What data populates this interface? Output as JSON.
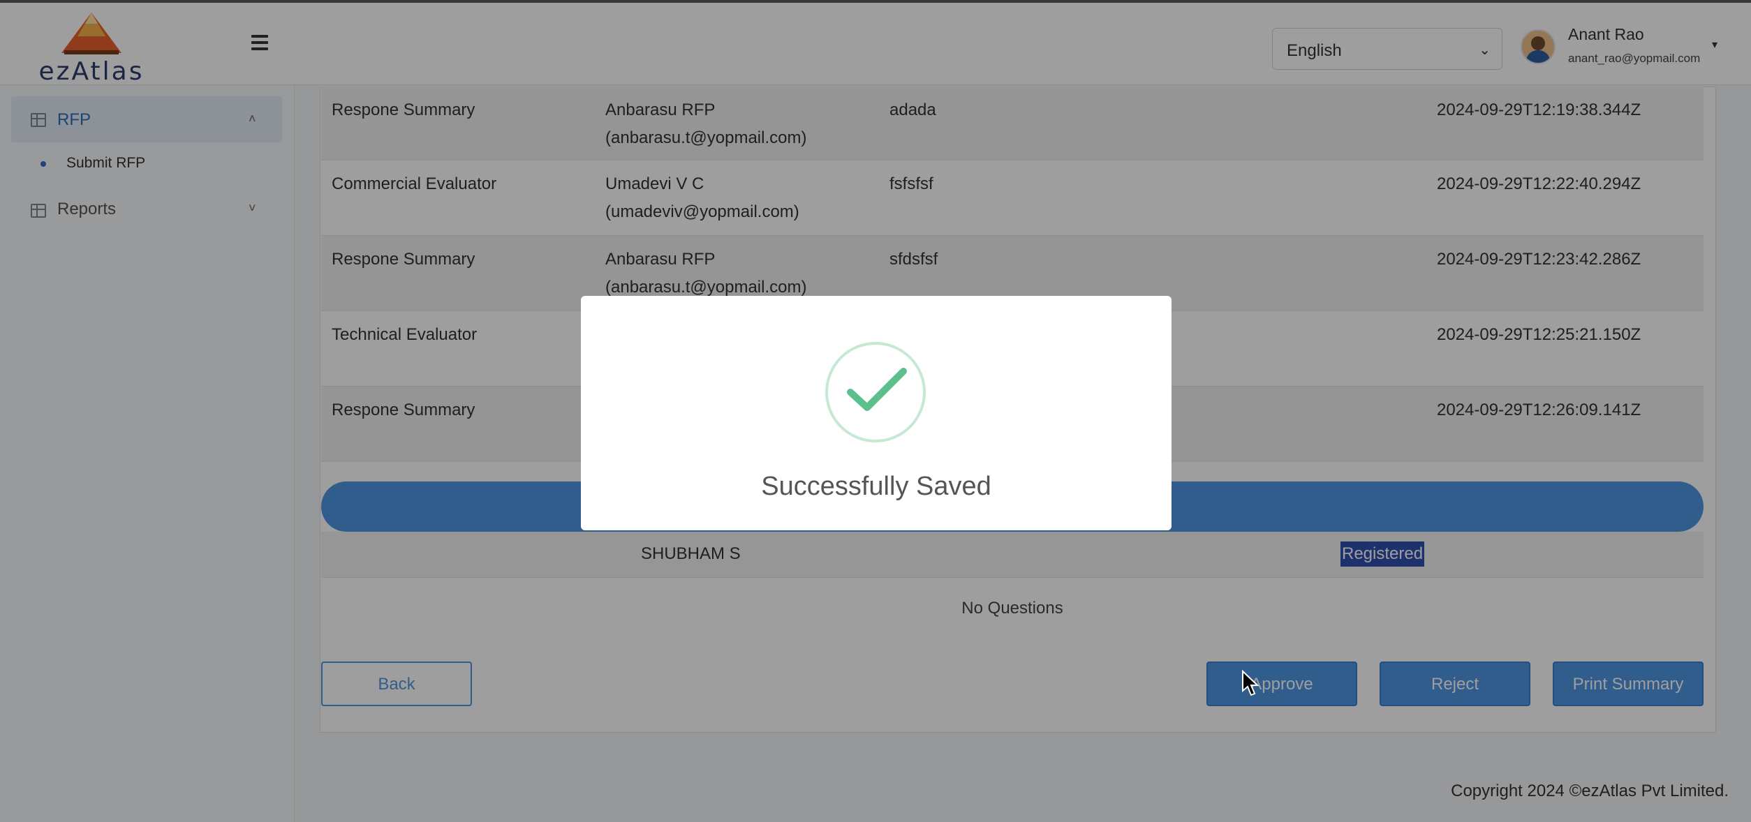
{
  "app": {
    "logo_text": "ezAtlas"
  },
  "header": {
    "language": "English",
    "user_name": "Anant Rao",
    "user_email": "anant_rao@yopmail.com"
  },
  "sidebar": {
    "items": [
      {
        "label": "RFP",
        "expanded": true
      },
      {
        "label": "Reports",
        "expanded": false
      }
    ],
    "sub_items": [
      {
        "label": "Submit RFP"
      }
    ]
  },
  "history_rows": [
    {
      "stage": "Respone Summary",
      "user_name": "Anbarasu RFP",
      "user_email": "(anbarasu.t@yopmail.com)",
      "comment": "adada",
      "timestamp": "2024-09-29T12:19:38.344Z"
    },
    {
      "stage": "Commercial Evaluator",
      "user_name": "Umadevi V C",
      "user_email": "(umadeviv@yopmail.com)",
      "comment": "fsfsfsf",
      "timestamp": "2024-09-29T12:22:40.294Z"
    },
    {
      "stage": "Respone Summary",
      "user_name": "Anbarasu RFP",
      "user_email": "(anbarasu.t@yopmail.com)",
      "comment": "sfdsfsf",
      "timestamp": "2024-09-29T12:23:42.286Z"
    },
    {
      "stage": "Technical Evaluator",
      "user_name": "",
      "user_email": "",
      "comment": "",
      "timestamp": "2024-09-29T12:25:21.150Z"
    },
    {
      "stage": "Respone Summary",
      "user_name": "",
      "user_email": "",
      "comment": "",
      "timestamp": "2024-09-29T12:26:09.141Z"
    }
  ],
  "vendor_row": {
    "name": "SHUBHAM S",
    "status": "Registered"
  },
  "questions_text": "No Questions",
  "buttons": {
    "back": "Back",
    "approve": "Approve",
    "reject": "Reject",
    "print": "Print Summary"
  },
  "modal": {
    "message": "Successfully Saved"
  },
  "footer": {
    "copyright": "Copyright 2024 ©ezAtlas Pvt Limited."
  },
  "colors": {
    "primary": "#4f97e4",
    "success": "#5cc08a",
    "badge": "#2f4fb0"
  },
  "icons": [
    "hamburger-icon",
    "table-icon",
    "chevron-up-icon",
    "chevron-down-icon",
    "check-icon",
    "avatar"
  ]
}
